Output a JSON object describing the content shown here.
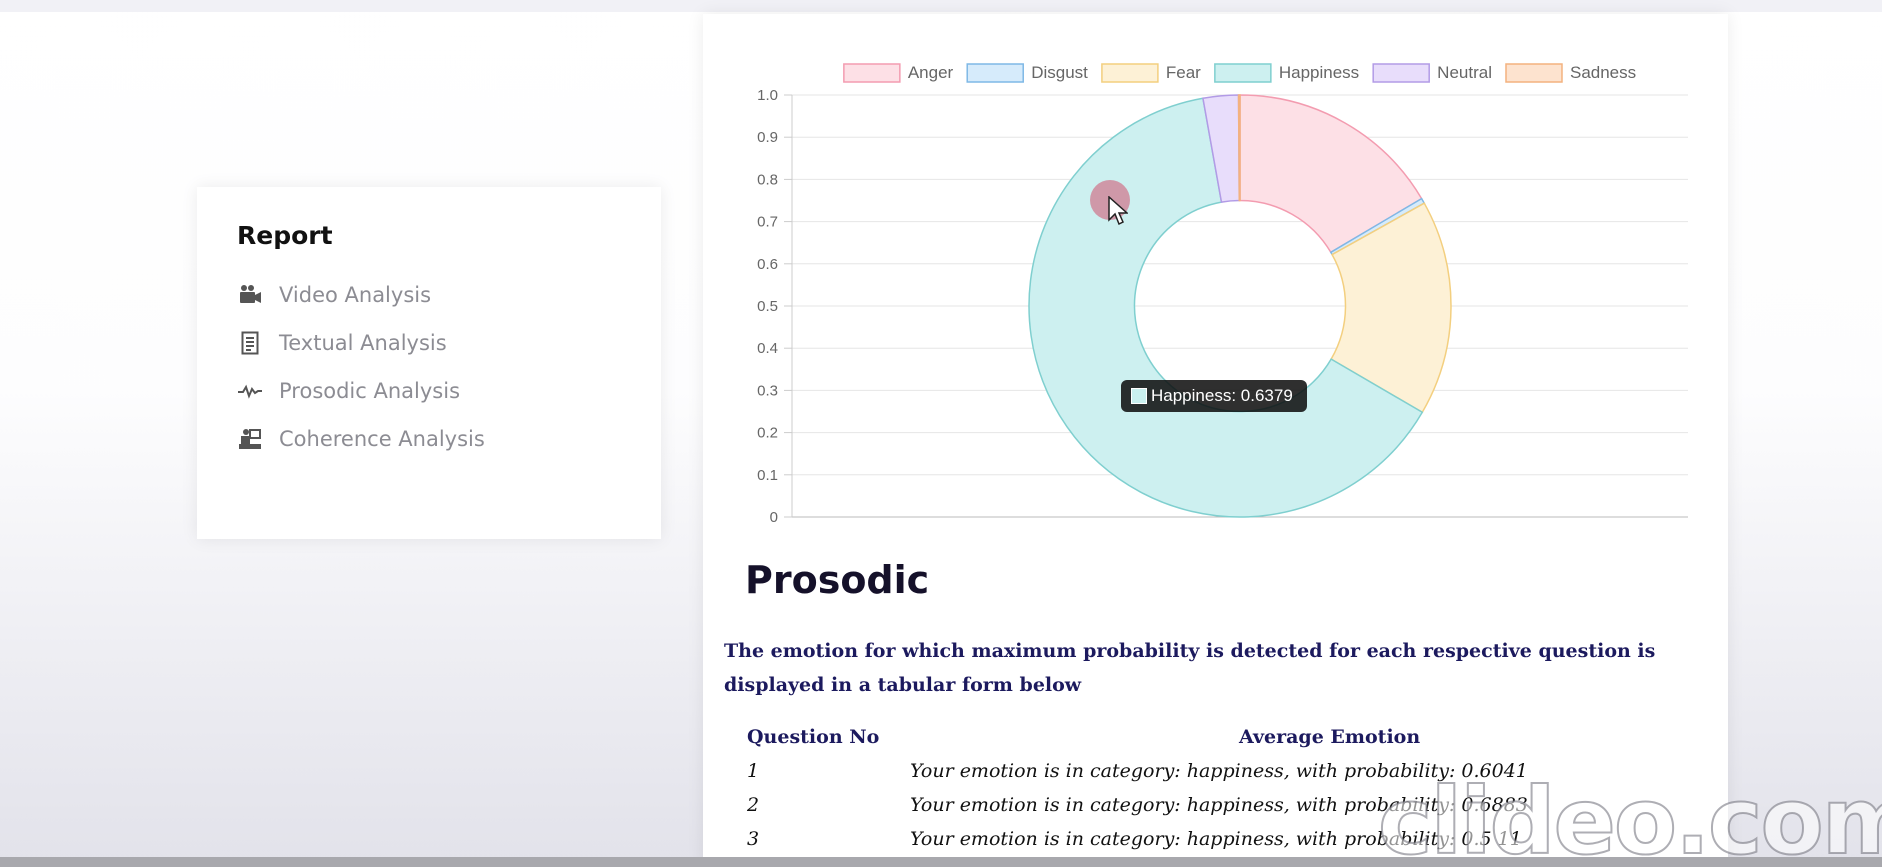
{
  "sidebar": {
    "title": "Report",
    "items": [
      {
        "label": "Video Analysis",
        "icon": "video-camera-icon"
      },
      {
        "label": "Textual Analysis",
        "icon": "document-icon"
      },
      {
        "label": "Prosodic Analysis",
        "icon": "waveform-icon"
      },
      {
        "label": "Coherence Analysis",
        "icon": "presentation-icon"
      }
    ]
  },
  "chart_data": {
    "type": "pie",
    "variant": "doughnut",
    "legend": [
      "Anger",
      "Disgust",
      "Fear",
      "Happiness",
      "Neutral",
      "Sadness"
    ],
    "legend_position": "top",
    "y_ticks": [
      "1.0",
      "0.9",
      "0.8",
      "0.7",
      "0.6",
      "0.5",
      "0.4",
      "0.3",
      "0.2",
      "0.1",
      "0"
    ],
    "ylim": [
      0,
      1
    ],
    "grid": true,
    "series": [
      {
        "name": "Anger",
        "value": 0.165,
        "fill": "#fde0e6",
        "stroke": "#f39cb0"
      },
      {
        "name": "Disgust",
        "value": 0.004,
        "fill": "#d6ebfb",
        "stroke": "#7fb8e6"
      },
      {
        "name": "Fear",
        "value": 0.165,
        "fill": "#fdf1d6",
        "stroke": "#f3cf7f"
      },
      {
        "name": "Happiness",
        "value": 0.6379,
        "fill": "#cdf0f0",
        "stroke": "#7fcfcf"
      },
      {
        "name": "Neutral",
        "value": 0.027,
        "fill": "#e8ddfb",
        "stroke": "#b29be6"
      },
      {
        "name": "Sadness",
        "value": 0.0011,
        "fill": "#fde3cf",
        "stroke": "#f3b27f"
      }
    ]
  },
  "tooltip": {
    "text": "Happiness: 0.6379"
  },
  "main": {
    "heading": "Prosodic",
    "description": "The emotion for which maximum probability is detected for each respective question is displayed in a tabular form below",
    "table": {
      "headers": [
        "Question No",
        "Average Emotion"
      ],
      "rows": [
        {
          "no": "1",
          "emotion": "Your emotion is in category: happiness, with probability: 0.6041"
        },
        {
          "no": "2",
          "emotion": "Your emotion is in category: happiness, with probability: 0.6883"
        },
        {
          "no": "3",
          "emotion": "Your emotion is in category: happiness, with probability: 0.5 11"
        }
      ]
    }
  },
  "watermark": "clideo.com"
}
